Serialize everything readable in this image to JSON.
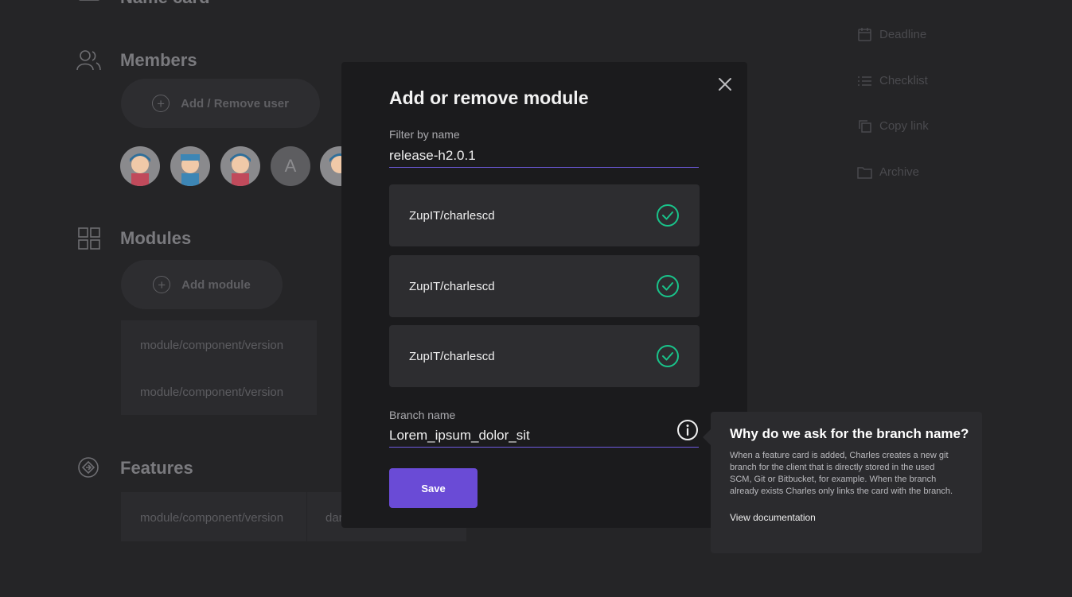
{
  "background": {
    "name_card": {
      "title": "Name card"
    },
    "members": {
      "title": "Members",
      "add_remove_label": "Add / Remove user",
      "avatars": [
        "avatar-1",
        "avatar-2",
        "avatar-3",
        "A",
        "avatar-5"
      ]
    },
    "modules": {
      "title": "Modules",
      "add_module_label": "Add module",
      "items": [
        "module/component/version",
        "module/component/version"
      ]
    },
    "features": {
      "title": "Features",
      "items": [
        "module/component/version",
        "dar"
      ]
    },
    "side_menu": [
      {
        "label": "Deadline",
        "icon": "calendar-icon"
      },
      {
        "label": "Checklist",
        "icon": "list-icon"
      },
      {
        "label": "Copy link",
        "icon": "copy-icon"
      },
      {
        "label": "Archive",
        "icon": "folder-icon"
      }
    ]
  },
  "modal": {
    "title": "Add or remove module",
    "filter": {
      "label": "Filter by name",
      "value": "release-h2.0.1"
    },
    "modules": [
      {
        "name": "ZupIT/charlescd",
        "selected": true
      },
      {
        "name": "ZupIT/charlescd",
        "selected": true
      },
      {
        "name": "ZupIT/charlescd",
        "selected": true
      }
    ],
    "branch": {
      "label": "Branch name",
      "value": "Lorem_ipsum_dolor_sit"
    },
    "save_label": "Save"
  },
  "tooltip": {
    "title": "Why do we ask for the branch name?",
    "body": "When a feature card is added, Charles creates a new git branch for the client that is directly stored in the used SCM, Git or Bitbucket, for example. When the branch already exists Charles only links the card with the branch.",
    "link": "View documentation"
  },
  "colors": {
    "accent": "#6a4bd6",
    "check": "#19c38a",
    "modal_bg": "#1b1b1d",
    "page_bg": "#252527"
  }
}
